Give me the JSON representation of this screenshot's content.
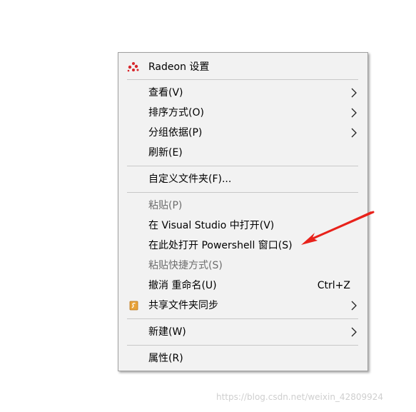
{
  "menu": {
    "items": [
      {
        "label": "Radeon 设置",
        "icon": "radeon-icon",
        "disabled": false
      },
      {
        "label": "查看(V)",
        "submenu": true,
        "disabled": false
      },
      {
        "label": "排序方式(O)",
        "submenu": true,
        "disabled": false
      },
      {
        "label": "分组依据(P)",
        "submenu": true,
        "disabled": false
      },
      {
        "label": "刷新(E)",
        "disabled": false
      },
      {
        "label": "自定义文件夹(F)...",
        "disabled": false
      },
      {
        "label": "粘贴(P)",
        "disabled": true
      },
      {
        "label": "在 Visual Studio 中打开(V)",
        "disabled": false
      },
      {
        "label": "在此处打开 Powershell 窗口(S)",
        "disabled": false
      },
      {
        "label": "粘贴快捷方式(S)",
        "disabled": true
      },
      {
        "label": "撤消 重命名(U)",
        "shortcut": "Ctrl+Z",
        "disabled": false
      },
      {
        "label": "共享文件夹同步",
        "icon": "sync-share-icon",
        "submenu": true,
        "disabled": false
      },
      {
        "label": "新建(W)",
        "submenu": true,
        "disabled": false
      },
      {
        "label": "属性(R)",
        "disabled": false
      }
    ]
  },
  "watermark": "https://blog.csdn.net/weixin_42809924",
  "colors": {
    "menu_bg": "#f2f2f2",
    "separator": "#c8c8c8",
    "disabled_text": "#6d6d6d",
    "annotation_arrow": "#e8221b",
    "radeon_red": "#d7262b",
    "sync_icon_orange": "#e8a33a"
  }
}
